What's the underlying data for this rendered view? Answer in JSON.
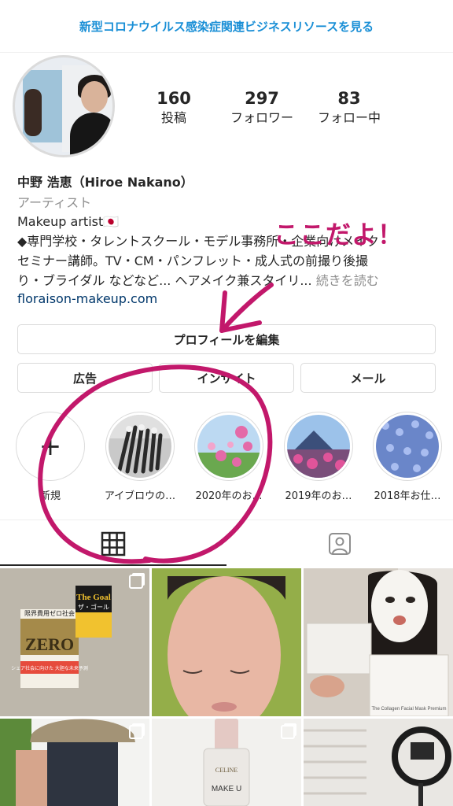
{
  "banner": {
    "text": "新型コロナウイルス感染症関連ビジネスリソースを見る"
  },
  "profile": {
    "stats": [
      {
        "num": "160",
        "label": "投稿"
      },
      {
        "num": "297",
        "label": "フォロワー"
      },
      {
        "num": "83",
        "label": "フォロー中"
      }
    ],
    "name": "中野 浩恵（Hiroe Nakano）",
    "category": "アーティスト",
    "bio_lines": [
      "Makeup artist🇯🇵",
      "◆専門学校・タレントスクール・モデル事務所・企業向けメイク",
      "セミナー講師。TV・CM・パンフレット・成人式の前撮り後撮",
      "り・ブライダル などなど... ヘアメイク兼スタイリ..."
    ],
    "more": "続きを読む",
    "link": "floraison-makeup.com"
  },
  "buttons": {
    "edit_profile": "プロフィールを編集",
    "ads": "広告",
    "insights": "インサイト",
    "mail": "メール"
  },
  "highlights": [
    {
      "label": "新規",
      "icon": "plus-icon"
    },
    {
      "label": "アイブロウの…"
    },
    {
      "label": "2020年のお…"
    },
    {
      "label": "2019年のお…"
    },
    {
      "label": "2018年お仕…"
    }
  ],
  "tabs": [
    {
      "icon": "grid-icon",
      "active": true
    },
    {
      "icon": "tagged-person-icon",
      "active": false
    }
  ],
  "posts": {
    "book_zero": {
      "title": "ZERO",
      "top_line": "限界費用ゼロ社会",
      "band": "シェア社会に向けた 大胆な未来予測"
    },
    "book_goal": {
      "title": "The Goal",
      "subtitle": "ザ・ゴール"
    },
    "mask_product": "The Collagen Facial Mask Premium",
    "bottle_brand": "CELINE",
    "bottle_label": "MAKE U"
  },
  "annotation": {
    "text": "ここだよ！",
    "color": "#c2186b"
  },
  "colors": {
    "link_blue": "#1a8fd6",
    "text": "#262626",
    "muted": "#8e8e8e",
    "annotation": "#c2186b"
  }
}
